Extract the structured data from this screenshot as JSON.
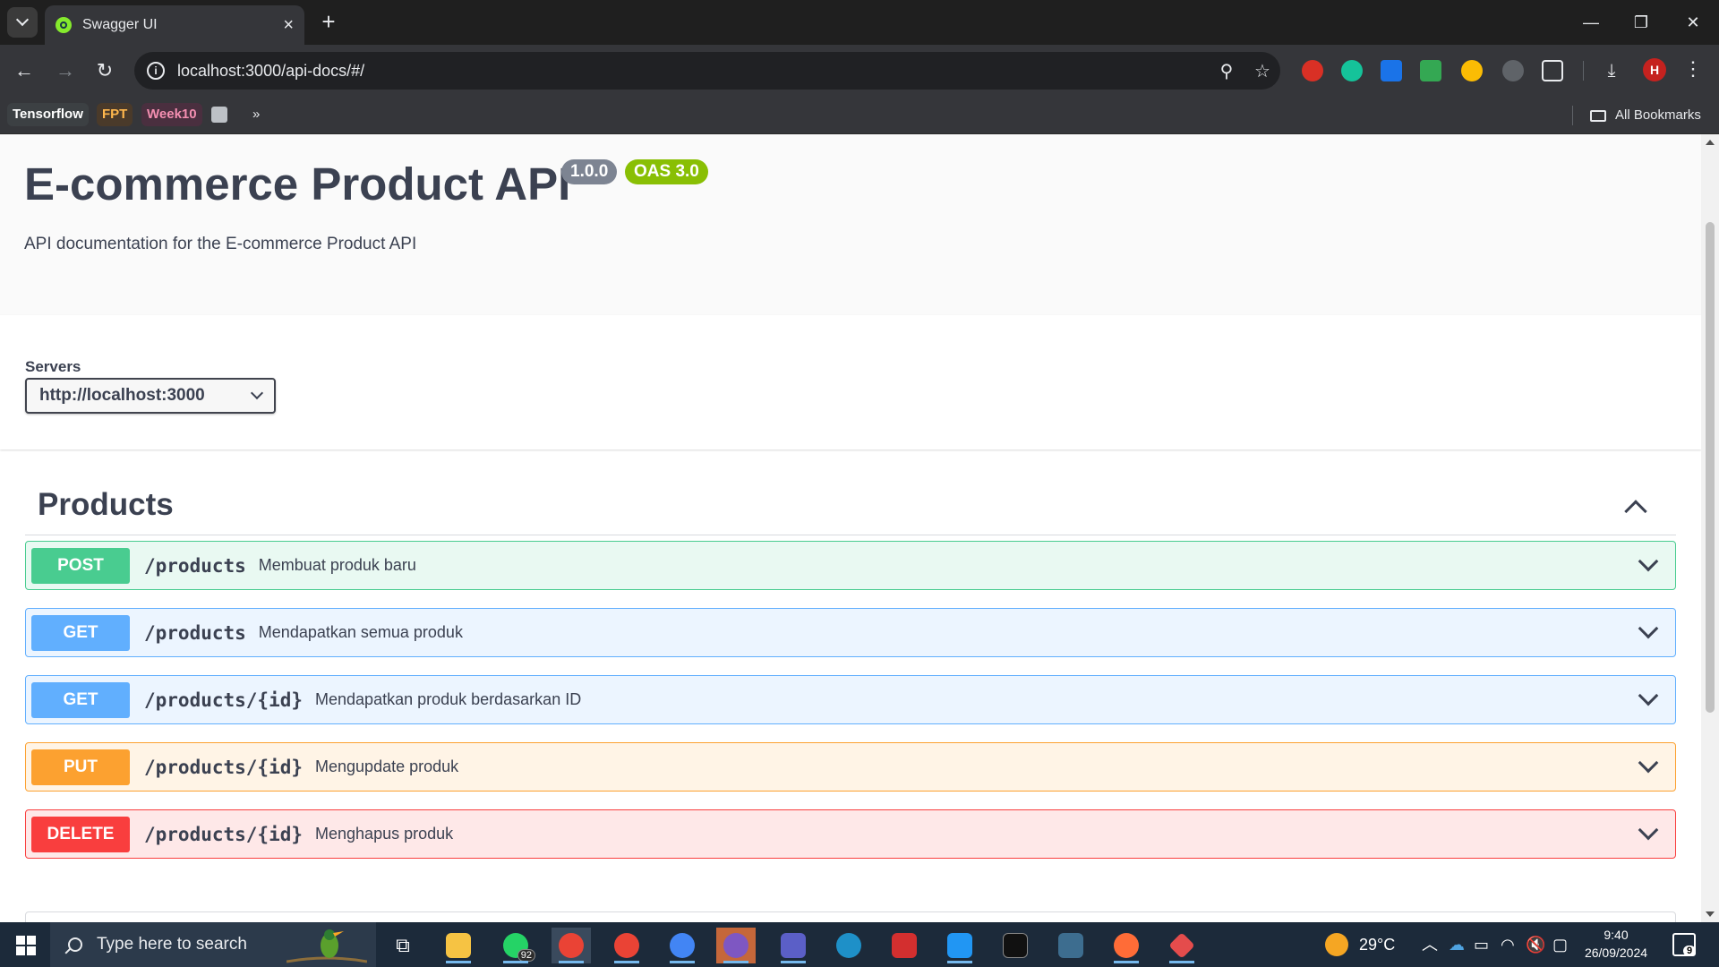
{
  "browser": {
    "tab_title": "Swagger UI",
    "url": "localhost:3000/api-docs/#/",
    "bookmarks": [
      {
        "label": "Tensorflow",
        "color": "#ffffff",
        "bg": "#3c4043"
      },
      {
        "label": "FPT",
        "color": "#ffb74d",
        "bg": "#4a3a2a"
      },
      {
        "label": "Week10",
        "color": "#f48fb1",
        "bg": "#4a2f3f"
      }
    ],
    "all_bookmarks_label": "All Bookmarks",
    "profile_initial": "H"
  },
  "info": {
    "title": "E-commerce Product API",
    "version": "1.0.0",
    "oas": "OAS 3.0",
    "description": "API documentation for the E-commerce Product API"
  },
  "servers": {
    "label": "Servers",
    "selected": "http://localhost:3000"
  },
  "tag": {
    "name": "Products",
    "operations": [
      {
        "method": "POST",
        "path": "/products",
        "summary": "Membuat produk baru",
        "kind": "post"
      },
      {
        "method": "GET",
        "path": "/products",
        "summary": "Mendapatkan semua produk",
        "kind": "get"
      },
      {
        "method": "GET",
        "path": "/products/{id}",
        "summary": "Mendapatkan produk berdasarkan ID",
        "kind": "get"
      },
      {
        "method": "PUT",
        "path": "/products/{id}",
        "summary": "Mengupdate produk",
        "kind": "put"
      },
      {
        "method": "DELETE",
        "path": "/products/{id}",
        "summary": "Menghapus produk",
        "kind": "delete"
      }
    ]
  },
  "taskbar": {
    "search_placeholder": "Type here to search",
    "whatsapp_badge": "92",
    "weather": "29°C",
    "time": "9:40",
    "date": "26/09/2024",
    "notification_count": "9"
  }
}
